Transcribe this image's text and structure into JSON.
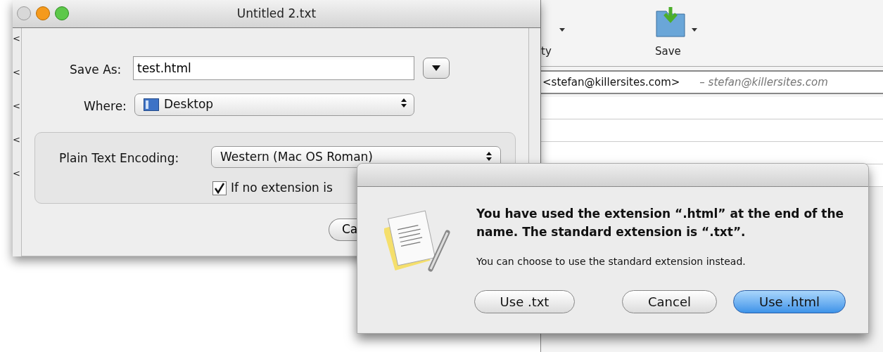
{
  "editor_window": {
    "title": "Untitled 2.txt",
    "gutter_marks": [
      "<",
      "<",
      "<",
      "<",
      "<"
    ]
  },
  "save_sheet": {
    "save_as_label": "Save As:",
    "save_as_value": "test.html",
    "where_label": "Where:",
    "where_value": "Desktop",
    "encoding_label": "Plain Text Encoding:",
    "encoding_value": "Western (Mac OS Roman)",
    "extension_checkbox": {
      "label": "If no extension is",
      "checked": true
    },
    "cancel_button": "Ca"
  },
  "mail_window": {
    "toolbar": [
      {
        "label": "ty",
        "kind": "cut"
      },
      {
        "label": "Save",
        "kind": "save"
      }
    ],
    "from_address": "<stefan@killersites.com>",
    "from_note": "– stefan@killersites.com"
  },
  "alert": {
    "title": "You have used the extension “.html” at the end of the name. The standard extension is “.txt”.",
    "message": "You can choose to use the standard extension instead.",
    "buttons": [
      {
        "label": "Use .txt",
        "default": false
      },
      {
        "label": "Cancel",
        "default": false
      },
      {
        "label": "Use .html",
        "default": true
      }
    ]
  }
}
